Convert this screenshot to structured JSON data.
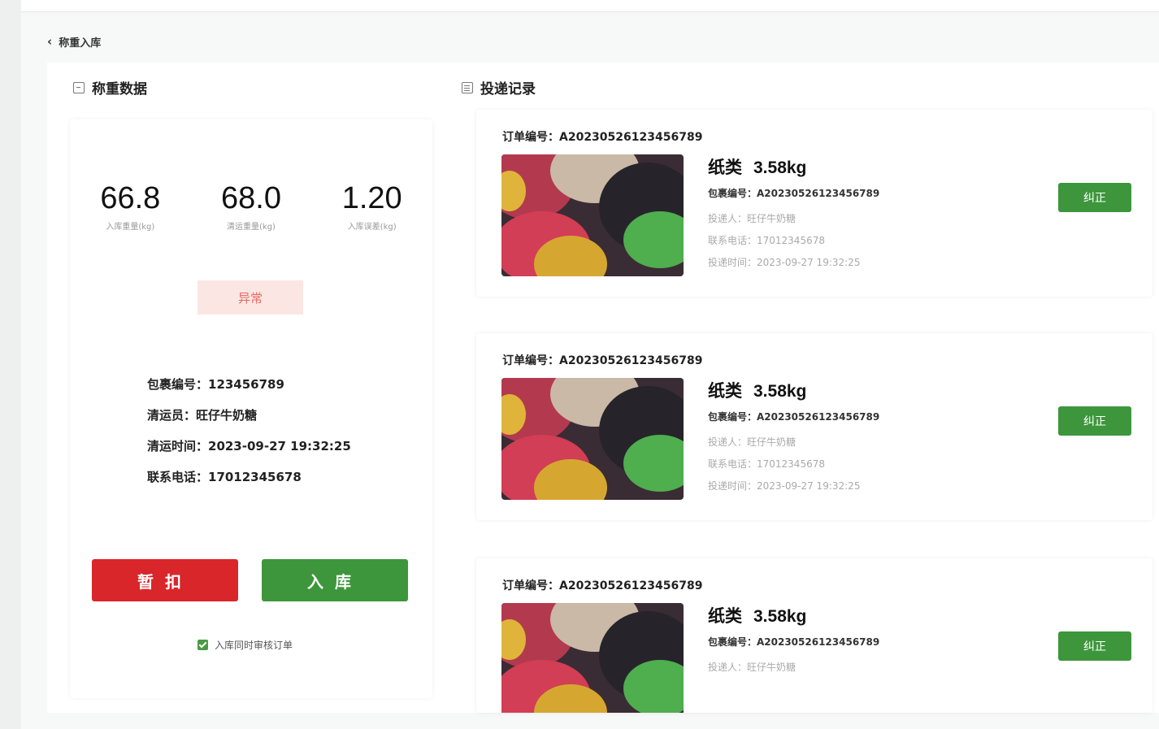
{
  "header": {
    "back_label": "称重入库"
  },
  "weigh_panel": {
    "title": "称重数据",
    "stats": [
      {
        "value": "66.8",
        "label": "入库重量(kg)"
      },
      {
        "value": "68.0",
        "label": "清运重量(kg)"
      },
      {
        "value": "1.20",
        "label": "入库误差(kg)"
      }
    ],
    "status_badge": "异常",
    "info": {
      "package_no": "包裹编号：123456789",
      "collector": "清运员：旺仔牛奶糖",
      "time": "清运时间：2023-09-27 19:32:25",
      "phone": "联系电话：17012345678"
    },
    "deduct_button": "暂扣",
    "store_button": "入库",
    "checkbox_label": "入库同时审核订单"
  },
  "records_panel": {
    "title": "投递记录",
    "records": [
      {
        "order": "订单编号：A20230526123456789",
        "category": "纸类",
        "weight": "3.58kg",
        "package": "包裹编号：A20230526123456789",
        "sender": "投递人：旺仔牛奶糖",
        "phone": "联系电话：17012345678",
        "time": "投递时间：2023-09-27 19:32:25",
        "action": "纠正"
      },
      {
        "order": "订单编号：A20230526123456789",
        "category": "纸类",
        "weight": "3.58kg",
        "package": "包裹编号：A20230526123456789",
        "sender": "投递人：旺仔牛奶糖",
        "phone": "联系电话：17012345678",
        "time": "投递时间：2023-09-27 19:32:25",
        "action": "纠正"
      },
      {
        "order": "订单编号：A20230526123456789",
        "category": "纸类",
        "weight": "3.58kg",
        "package": "包裹编号：A20230526123456789",
        "sender": "投递人：旺仔牛奶糖",
        "action": "纠正"
      }
    ]
  },
  "colors": {
    "primary_green": "#3d963b",
    "danger_red": "#d9262a",
    "badge_bg": "#fbe6e3"
  }
}
